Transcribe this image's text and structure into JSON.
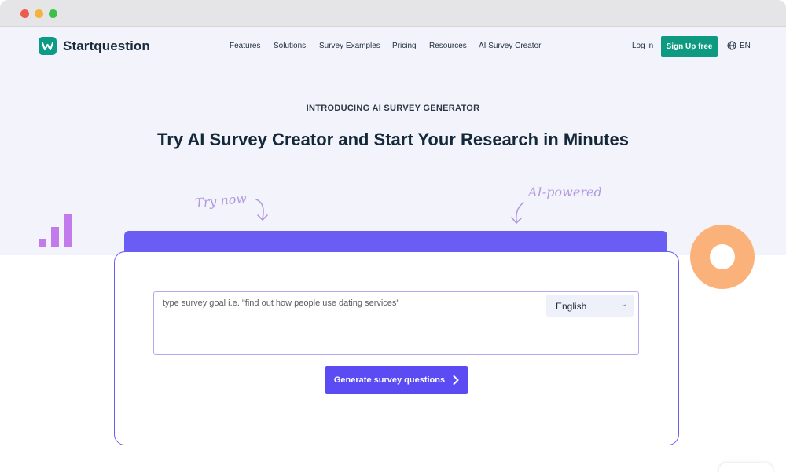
{
  "brand": {
    "name": "Startquestion",
    "logo_letter": "W",
    "accent": "#0e9a80"
  },
  "nav": {
    "items": [
      {
        "label": "Features"
      },
      {
        "label": "Solutions"
      },
      {
        "label": "Survey Examples"
      },
      {
        "label": "Pricing"
      },
      {
        "label": "Resources"
      },
      {
        "label": "AI Survey Creator"
      }
    ],
    "login": "Log in",
    "signup": "Sign Up free",
    "language": "EN",
    "language_icon": "globe-icon"
  },
  "hero": {
    "eyebrow": "INTRODUCING AI SURVEY GENERATOR",
    "title": "Try AI Survey Creator and Start Your Research in Minutes",
    "annotation_left": "Try now",
    "annotation_right": "AI-powered"
  },
  "generator": {
    "placeholder": "type survey goal i.e. \"find out how people use dating services\"",
    "language_selected": "English",
    "button_label": "Generate survey questions",
    "button_color": "#5a4bf2"
  }
}
